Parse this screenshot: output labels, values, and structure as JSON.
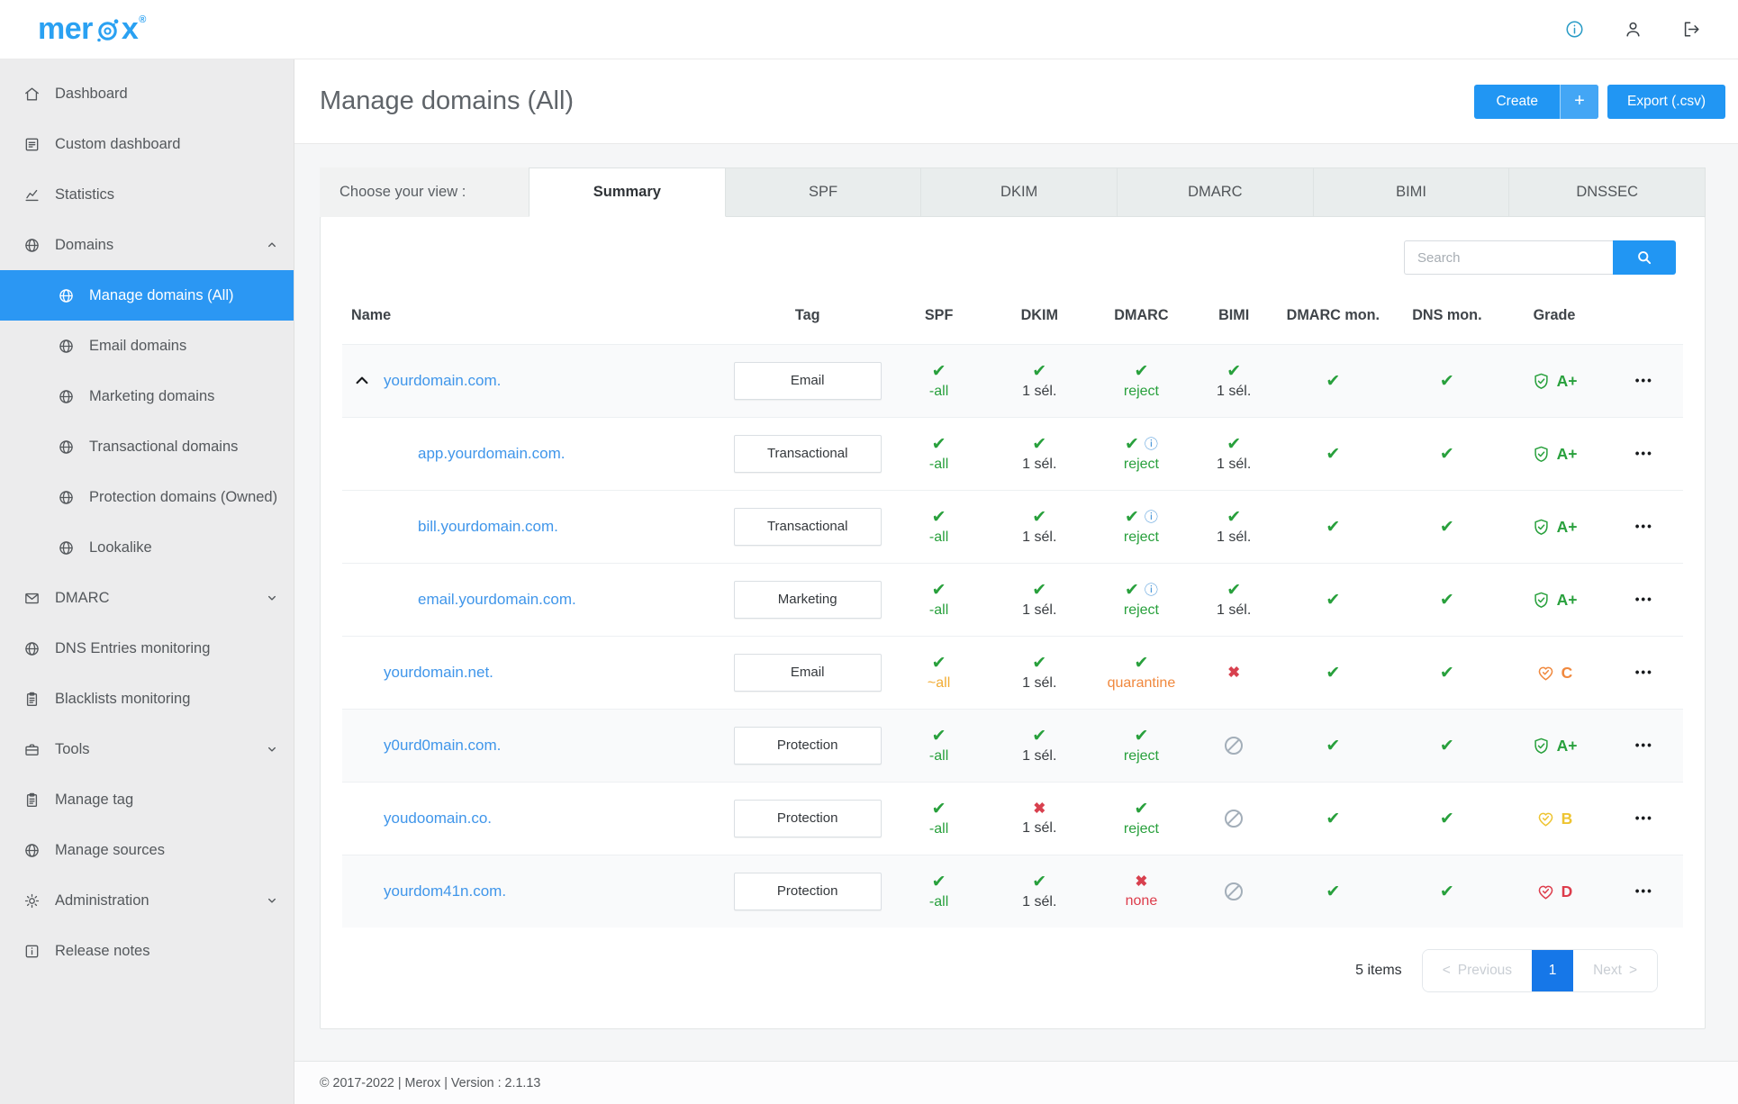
{
  "brand": {
    "name": "merox",
    "prefix": "mer",
    "suffix": "x",
    "registered": "®"
  },
  "topbar": {
    "icons": [
      "info",
      "user",
      "logout"
    ]
  },
  "sidebar": {
    "items": [
      {
        "label": "Dashboard",
        "icon": "home"
      },
      {
        "label": "Custom dashboard",
        "icon": "custom-dashboard"
      },
      {
        "label": "Statistics",
        "icon": "statistics"
      },
      {
        "label": "Domains",
        "icon": "globe",
        "chevron": "up"
      },
      {
        "label": "Manage domains (All)",
        "icon": "globe",
        "sub": true,
        "active": true
      },
      {
        "label": "Email domains",
        "icon": "globe",
        "sub": true
      },
      {
        "label": "Marketing domains",
        "icon": "globe",
        "sub": true
      },
      {
        "label": "Transactional domains",
        "icon": "globe",
        "sub": true
      },
      {
        "label": "Protection domains (Owned)",
        "icon": "globe",
        "sub": true
      },
      {
        "label": "Lookalike",
        "icon": "globe",
        "sub": true
      },
      {
        "label": "DMARC",
        "icon": "envelope",
        "chevron": "down"
      },
      {
        "label": "DNS Entries monitoring",
        "icon": "globe"
      },
      {
        "label": "Blacklists monitoring",
        "icon": "clipboard"
      },
      {
        "label": "Tools",
        "icon": "toolbox",
        "chevron": "down"
      },
      {
        "label": "Manage tag",
        "icon": "clipboard"
      },
      {
        "label": "Manage sources",
        "icon": "globe"
      },
      {
        "label": "Administration",
        "icon": "gear",
        "chevron": "down"
      },
      {
        "label": "Release notes",
        "icon": "info-square"
      }
    ]
  },
  "page": {
    "title": "Manage domains (All)",
    "create_label": "Create",
    "create_plus": "+",
    "export_label": "Export (.csv)"
  },
  "view": {
    "label": "Choose your view :",
    "tabs": [
      {
        "label": "Summary",
        "active": true
      },
      {
        "label": "SPF"
      },
      {
        "label": "DKIM"
      },
      {
        "label": "DMARC"
      },
      {
        "label": "BIMI"
      },
      {
        "label": "DNSSEC"
      }
    ]
  },
  "search": {
    "placeholder": "Search"
  },
  "table": {
    "headers": [
      "Name",
      "Tag",
      "SPF",
      "DKIM",
      "DMARC",
      "BIMI",
      "DMARC mon.",
      "DNS mon.",
      "Grade"
    ],
    "rows": [
      {
        "name": "yourdomain.com.",
        "indent": false,
        "expander": true,
        "shade": true,
        "tag": "Email",
        "spf": {
          "mark": "check",
          "label": "-all",
          "tone": "green"
        },
        "dkim": {
          "mark": "check",
          "label": "1 sél.",
          "tone": "plain"
        },
        "dmarc": {
          "mark": "check",
          "info": false,
          "label": "reject",
          "tone": "green"
        },
        "bimi": {
          "mark": "check",
          "label": "1 sél.",
          "tone": "plain"
        },
        "dmarc_mon": {
          "mark": "check"
        },
        "dns_mon": {
          "mark": "check"
        },
        "grade": {
          "letter": "A+",
          "icon": "shield",
          "tone": "green"
        }
      },
      {
        "name": "app.yourdomain.com.",
        "indent": true,
        "expander": false,
        "shade": false,
        "tag": "Transactional",
        "spf": {
          "mark": "check",
          "label": "-all",
          "tone": "green"
        },
        "dkim": {
          "mark": "check",
          "label": "1 sél.",
          "tone": "plain"
        },
        "dmarc": {
          "mark": "check",
          "info": true,
          "label": "reject",
          "tone": "green"
        },
        "bimi": {
          "mark": "check",
          "label": "1 sél.",
          "tone": "plain"
        },
        "dmarc_mon": {
          "mark": "check"
        },
        "dns_mon": {
          "mark": "check"
        },
        "grade": {
          "letter": "A+",
          "icon": "shield",
          "tone": "green"
        }
      },
      {
        "name": "bill.yourdomain.com.",
        "indent": true,
        "expander": false,
        "shade": false,
        "tag": "Transactional",
        "spf": {
          "mark": "check",
          "label": "-all",
          "tone": "green"
        },
        "dkim": {
          "mark": "check",
          "label": "1 sél.",
          "tone": "plain"
        },
        "dmarc": {
          "mark": "check",
          "info": true,
          "label": "reject",
          "tone": "green"
        },
        "bimi": {
          "mark": "check",
          "label": "1 sél.",
          "tone": "plain"
        },
        "dmarc_mon": {
          "mark": "check"
        },
        "dns_mon": {
          "mark": "check"
        },
        "grade": {
          "letter": "A+",
          "icon": "shield",
          "tone": "green"
        }
      },
      {
        "name": "email.yourdomain.com.",
        "indent": true,
        "expander": false,
        "shade": false,
        "tag": "Marketing",
        "spf": {
          "mark": "check",
          "label": "-all",
          "tone": "green"
        },
        "dkim": {
          "mark": "check",
          "label": "1 sél.",
          "tone": "plain"
        },
        "dmarc": {
          "mark": "check",
          "info": true,
          "label": "reject",
          "tone": "green"
        },
        "bimi": {
          "mark": "check",
          "label": "1 sél.",
          "tone": "plain"
        },
        "dmarc_mon": {
          "mark": "check"
        },
        "dns_mon": {
          "mark": "check"
        },
        "grade": {
          "letter": "A+",
          "icon": "shield",
          "tone": "green"
        }
      },
      {
        "name": "yourdomain.net.",
        "indent": false,
        "expander": false,
        "shade": false,
        "tag": "Email",
        "spf": {
          "mark": "check",
          "label": "~all",
          "tone": "amber"
        },
        "dkim": {
          "mark": "check",
          "label": "1 sél.",
          "tone": "plain"
        },
        "dmarc": {
          "mark": "check",
          "info": false,
          "label": "quarantine",
          "tone": "orange"
        },
        "bimi": {
          "mark": "cross",
          "label": "",
          "tone": "plain"
        },
        "dmarc_mon": {
          "mark": "check"
        },
        "dns_mon": {
          "mark": "check"
        },
        "grade": {
          "letter": "C",
          "icon": "heart",
          "tone": "orange"
        }
      },
      {
        "name": "y0urd0main.com.",
        "indent": false,
        "expander": false,
        "shade": true,
        "tag": "Protection",
        "spf": {
          "mark": "check",
          "label": "-all",
          "tone": "green"
        },
        "dkim": {
          "mark": "check",
          "label": "1 sél.",
          "tone": "plain"
        },
        "dmarc": {
          "mark": "check",
          "info": false,
          "label": "reject",
          "tone": "green"
        },
        "bimi": {
          "mark": "banned",
          "label": "",
          "tone": "plain"
        },
        "dmarc_mon": {
          "mark": "check"
        },
        "dns_mon": {
          "mark": "check"
        },
        "grade": {
          "letter": "A+",
          "icon": "shield",
          "tone": "green"
        }
      },
      {
        "name": "youdoomain.co.",
        "indent": false,
        "expander": false,
        "shade": false,
        "tag": "Protection",
        "spf": {
          "mark": "check",
          "label": "-all",
          "tone": "green"
        },
        "dkim": {
          "mark": "cross",
          "label": "1 sél.",
          "tone": "plain"
        },
        "dmarc": {
          "mark": "check",
          "info": false,
          "label": "reject",
          "tone": "green"
        },
        "bimi": {
          "mark": "banned",
          "label": "",
          "tone": "plain"
        },
        "dmarc_mon": {
          "mark": "check"
        },
        "dns_mon": {
          "mark": "check"
        },
        "grade": {
          "letter": "B",
          "icon": "heart",
          "tone": "yellow"
        }
      },
      {
        "name": "yourdom41n.com.",
        "indent": false,
        "expander": false,
        "shade": true,
        "tag": "Protection",
        "spf": {
          "mark": "check",
          "label": "-all",
          "tone": "green"
        },
        "dkim": {
          "mark": "check",
          "label": "1 sél.",
          "tone": "plain"
        },
        "dmarc": {
          "mark": "cross",
          "info": false,
          "label": "none",
          "tone": "red"
        },
        "bimi": {
          "mark": "banned",
          "label": "",
          "tone": "plain"
        },
        "dmarc_mon": {
          "mark": "check"
        },
        "dns_mon": {
          "mark": "check"
        },
        "grade": {
          "letter": "D",
          "icon": "heart",
          "tone": "red"
        }
      }
    ]
  },
  "pagination": {
    "count_label": "5 items",
    "previous_arrow": "<",
    "previous": "Previous",
    "page": "1",
    "next": "Next",
    "next_arrow": ">"
  },
  "footer": {
    "text": "© 2017-2022 | Merox | Version : 2.1.13"
  },
  "colors": {
    "accent": "#2196f3",
    "link": "#4096ea",
    "green": "#28a03c",
    "orange": "#f0883d",
    "amber": "#f2ac34",
    "yellow": "#eec431",
    "red": "#dd3c4b",
    "muted": "#a3aeb9"
  }
}
